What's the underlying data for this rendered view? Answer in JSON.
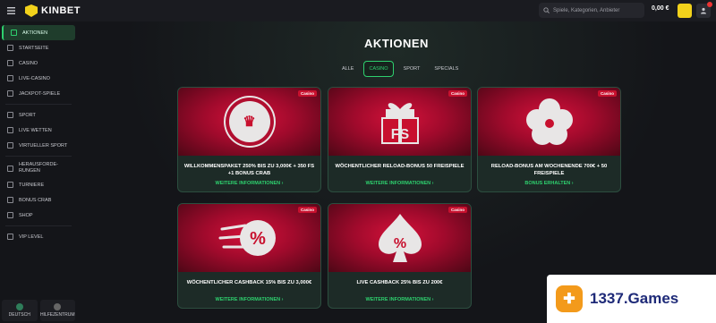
{
  "header": {
    "logo_text": "KINBET",
    "search_placeholder": "Spiele, Kategorien, Anbieter",
    "balance": "0,00 €"
  },
  "sidebar": {
    "items": [
      {
        "label": "AKTIONEN",
        "icon": "gift-icon",
        "active": true
      },
      {
        "label": "STARTSEITE",
        "icon": "home-icon"
      },
      {
        "label": "CASINO",
        "icon": "slot-icon"
      },
      {
        "label": "LIVE-CASINO",
        "icon": "card-icon"
      },
      {
        "label": "JACKPOT-SPIELE",
        "icon": "jackpot-icon"
      },
      {
        "label": "SPORT",
        "icon": "ball-icon"
      },
      {
        "label": "LIVE WETTEN",
        "icon": "live-icon"
      },
      {
        "label": "VIRTUELLER SPORT",
        "icon": "virtual-icon"
      },
      {
        "label": "HERAUSFORDE-RUNGEN",
        "icon": "challenge-icon"
      },
      {
        "label": "TURNIERE",
        "icon": "trophy-icon"
      },
      {
        "label": "BONUS CRAB",
        "icon": "crab-icon"
      },
      {
        "label": "SHOP",
        "icon": "shop-icon"
      },
      {
        "label": "VIP LEVEL",
        "icon": "vip-icon"
      }
    ],
    "footer": {
      "language": "DEUTSCH",
      "help": "HILFEZENTRUM"
    }
  },
  "main": {
    "title": "AKTIONEN",
    "tabs": [
      "ALLE",
      "CASINO",
      "SPORT",
      "SPECIALS"
    ],
    "active_tab": "CASINO",
    "cards": [
      {
        "badge": "Casino",
        "name": "WILLKOMMENSPAKET 250% BIS ZU 3,000€ + 350 FS +1 BONUS CRAB",
        "link": "WEITERE INFORMATIONEN",
        "art": "chip-icon"
      },
      {
        "badge": "Casino",
        "name": "WÖCHENTLICHER RELOAD-BONUS 50 FREISPIELE",
        "link": "WEITERE INFORMATIONEN",
        "art": "gift-fs-icon"
      },
      {
        "badge": "Casino",
        "name": "RELOAD-BONUS AM WOCHENENDE 700€ + 50 FREISPIELE",
        "link": "BONUS ERHALTEN",
        "art": "clover-icon"
      },
      {
        "badge": "Casino",
        "name": "WÖCHENTLICHER CASHBACK 15% BIS ZU 3,000€",
        "link": "WEITERE INFORMATIONEN",
        "art": "percent-icon"
      },
      {
        "badge": "Casino",
        "name": "LIVE CASHBACK 25% BIS ZU 200€",
        "link": "WEITERE INFORMATIONEN",
        "art": "spade-percent-icon"
      }
    ]
  },
  "watermark": {
    "text": "1337.Games"
  },
  "colors": {
    "accent": "#2ed06e",
    "brand_red": "#c8102e",
    "logo_yellow": "#f2d21b"
  }
}
